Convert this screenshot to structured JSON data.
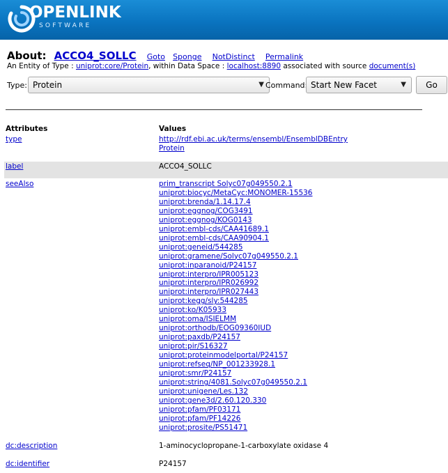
{
  "logo": {
    "brand": "OPENLINK",
    "sub": "SOFTWARE"
  },
  "about": {
    "label": "About:",
    "entity": "ACCO4_SOLLC",
    "actions": [
      "Goto",
      "Sponge",
      "NotDistinct",
      "Permalink"
    ]
  },
  "entity_line": {
    "prefix": "An Entity of Type :",
    "type_link": "uniprot:core/Protein",
    "mid": ", within Data Space :",
    "space_link": "localhost:8890",
    "suffix": "associated with source",
    "source_link": "document(s)"
  },
  "form": {
    "type_label": "Type:",
    "type_value": "Protein",
    "command_label": "Command:",
    "command_value": "Start New Facet",
    "go_label": "Go"
  },
  "table": {
    "headers": {
      "attributes": "Attributes",
      "values": "Values"
    },
    "rows": [
      {
        "attr": "type",
        "values": [
          "http://rdf.ebi.ac.uk/terms/ensembl/EnsemblDBEntry",
          "Protein"
        ],
        "links": true
      },
      {
        "attr": "label",
        "values": [
          "ACCO4_SOLLC"
        ],
        "links": false
      },
      {
        "attr": "seeAlso",
        "values": [
          "prim_transcript Solyc07g049550.2.1",
          "uniprot:biocyc/MetaCyc:MONOMER-15536",
          "uniprot:brenda/1.14.17.4",
          "uniprot:eggnog/COG3491",
          "uniprot:eggnog/KOG0143",
          "uniprot:embl-cds/CAA41689.1",
          "uniprot:embl-cds/CAA90904.1",
          "uniprot:geneid/544285",
          "uniprot:gramene/Solyc07g049550.2.1",
          "uniprot:inparanoid/P24157",
          "uniprot:interpro/IPR005123",
          "uniprot:interpro/IPR026992",
          "uniprot:interpro/IPR027443",
          "uniprot:kegg/sly:544285",
          "uniprot:ko/K05933",
          "uniprot:oma/ISIELMM",
          "uniprot:orthodb/EOG09360IUD",
          "uniprot:paxdb/P24157",
          "uniprot:pir/S16327",
          "uniprot:proteinmodelportal/P24157",
          "uniprot:refseq/NP_001233928.1",
          "uniprot:smr/P24157",
          "uniprot:string/4081.Solyc07g049550.2.1",
          "uniprot:unigene/Les.132",
          "uniprot:gene3d/2.60.120.330",
          "uniprot:pfam/PF03171",
          "uniprot:pfam/PF14226",
          "uniprot:prosite/PS51471"
        ],
        "links": true
      },
      {
        "attr": "dc:description",
        "values": [
          "1-aminocyclopropane-1-carboxylate oxidase 4"
        ],
        "links": false
      },
      {
        "attr": "dc:identifier",
        "values": [
          "P24157"
        ],
        "links": false
      }
    ]
  }
}
